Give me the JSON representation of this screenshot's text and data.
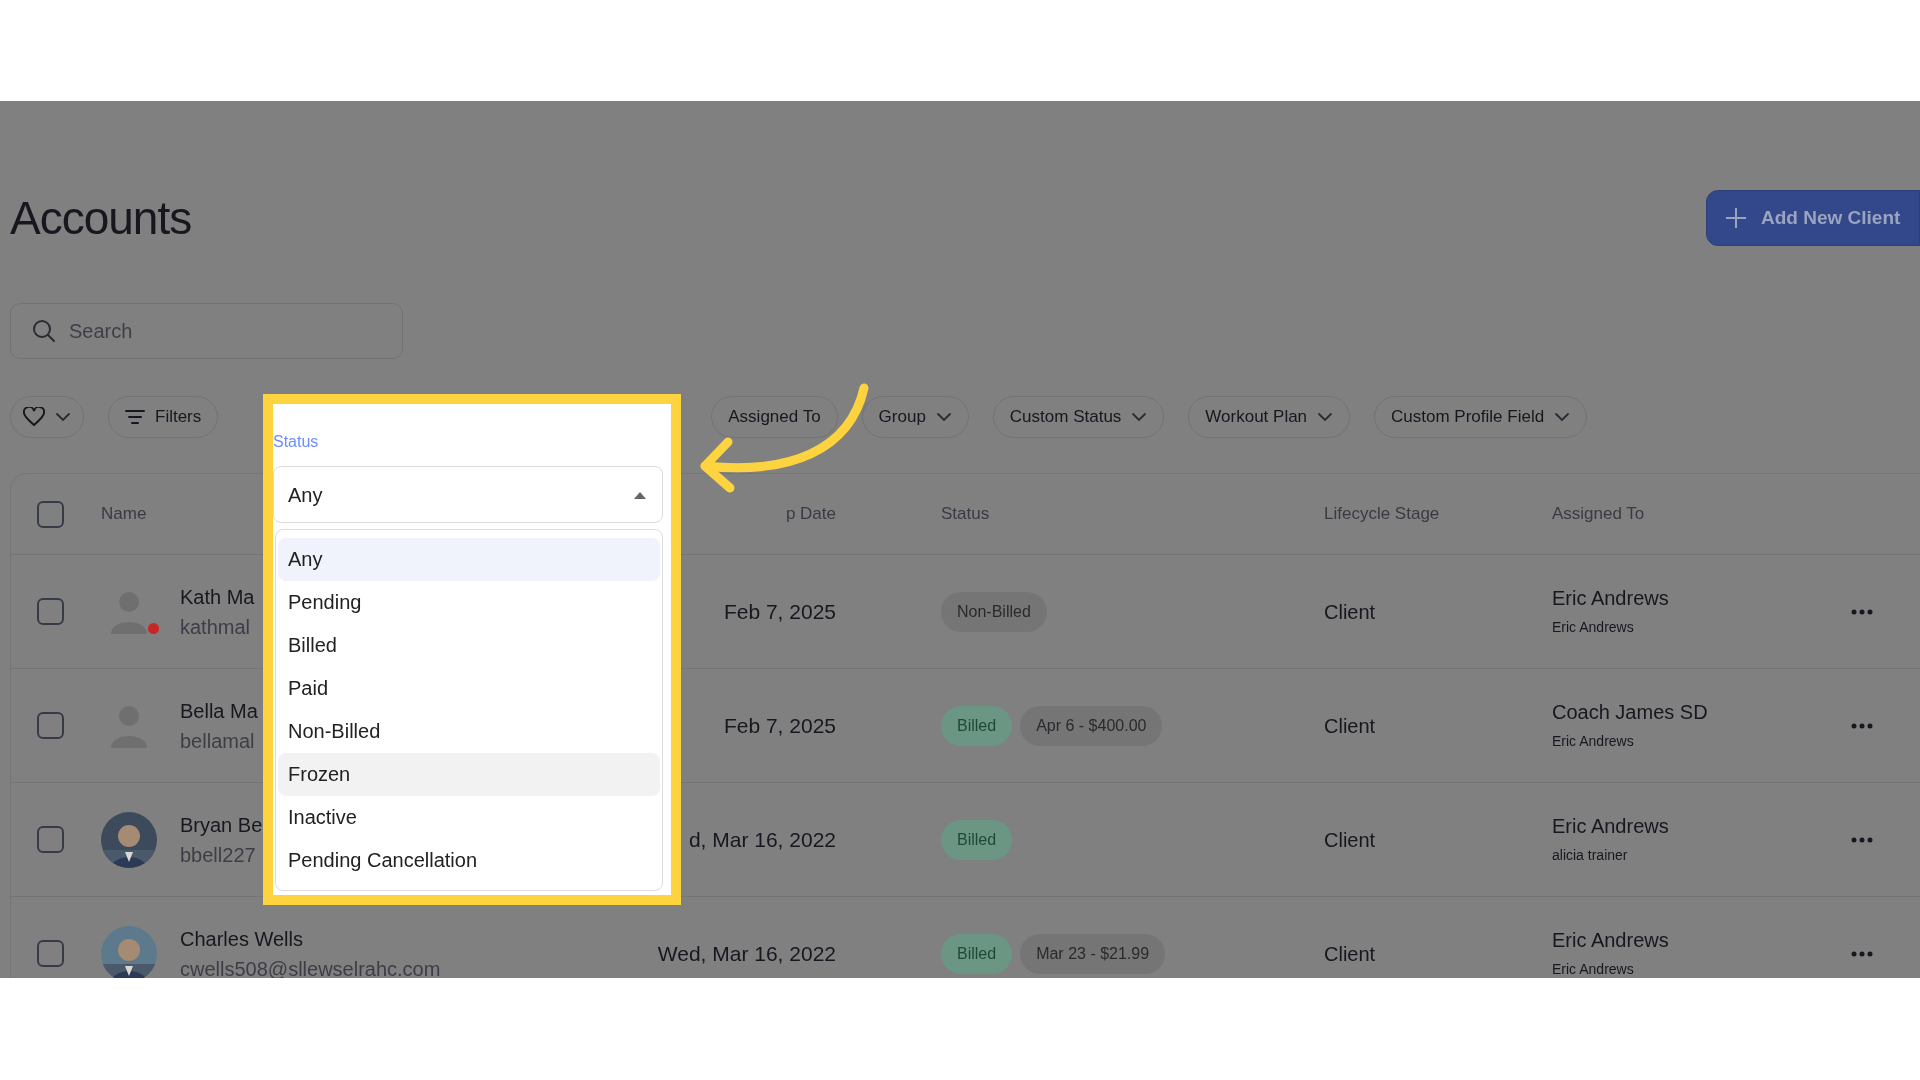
{
  "page": {
    "title": "Accounts",
    "add_button": "Add New Client",
    "search": {
      "placeholder": "Search"
    }
  },
  "filters": [
    {
      "kind": "favorites",
      "caret": true
    },
    {
      "kind": "filters",
      "label": "Filters",
      "caret": false
    },
    {
      "kind": "chip",
      "label": "Assigned To",
      "caret": false
    },
    {
      "kind": "chip",
      "label": "Group",
      "caret": true
    },
    {
      "kind": "chip",
      "label": "Custom Status",
      "caret": true
    },
    {
      "kind": "chip",
      "label": "Workout Plan",
      "caret": true
    },
    {
      "kind": "chip",
      "label": "Custom Profile Field",
      "caret": true
    }
  ],
  "table": {
    "select_all": {
      "checked": false
    },
    "columns": [
      "Name",
      "p Date",
      "Status",
      "Lifecycle Stage",
      "Assigned To"
    ],
    "rows": [
      {
        "checked": false,
        "avatar": {
          "kind": "silhouette"
        },
        "status_dot": true,
        "name": "Kath Ma",
        "email": "kathmal",
        "date": "Feb 7, 2025",
        "badges": [
          {
            "label": "Non-Billed",
            "kind": "neutral"
          }
        ],
        "stage": "Client",
        "assigned": "Eric Andrews",
        "assigned_sub": "Eric Andrews"
      },
      {
        "checked": false,
        "avatar": {
          "kind": "silhouette"
        },
        "status_dot": false,
        "name": "Bella Ma",
        "email": "bellamal",
        "date": "Feb 7, 2025",
        "badges": [
          {
            "label": "Billed",
            "kind": "billed"
          },
          {
            "label": "Apr 6 - $400.00",
            "kind": "neutral"
          }
        ],
        "stage": "Client",
        "assigned": "Coach James SD",
        "assigned_sub": "Eric Andrews"
      },
      {
        "checked": false,
        "avatar": {
          "kind": "picture"
        },
        "status_dot": false,
        "name": "Bryan Be",
        "email": "bbell227",
        "date": "d, Mar 16, 2022",
        "badges": [
          {
            "label": "Billed",
            "kind": "billed"
          }
        ],
        "stage": "Client",
        "assigned": "Eric Andrews",
        "assigned_sub": "alicia trainer"
      },
      {
        "checked": false,
        "avatar": {
          "kind": "picture"
        },
        "status_dot": false,
        "name": "Charles Wells",
        "email": "cwells508@sllewselrahc.com",
        "date": "Wed, Mar 16, 2022",
        "badges": [
          {
            "label": "Billed",
            "kind": "billed"
          },
          {
            "label": "Mar 23 - $21.99",
            "kind": "neutral"
          }
        ],
        "stage": "Client",
        "assigned": "Eric Andrews",
        "assigned_sub": "Eric Andrews"
      }
    ]
  },
  "status_dropdown": {
    "label": "Status",
    "value": "Any",
    "expanded": true,
    "options": [
      {
        "label": "Any",
        "selected": true,
        "hovered": false
      },
      {
        "label": "Pending",
        "selected": false,
        "hovered": false
      },
      {
        "label": "Billed",
        "selected": false,
        "hovered": false
      },
      {
        "label": "Paid",
        "selected": false,
        "hovered": false
      },
      {
        "label": "Non-Billed",
        "selected": false,
        "hovered": false
      },
      {
        "label": "Frozen",
        "selected": false,
        "hovered": true
      },
      {
        "label": "Inactive",
        "selected": false,
        "hovered": false
      },
      {
        "label": "Pending Cancellation",
        "selected": false,
        "hovered": false
      }
    ]
  },
  "callout": {
    "shown": true
  }
}
